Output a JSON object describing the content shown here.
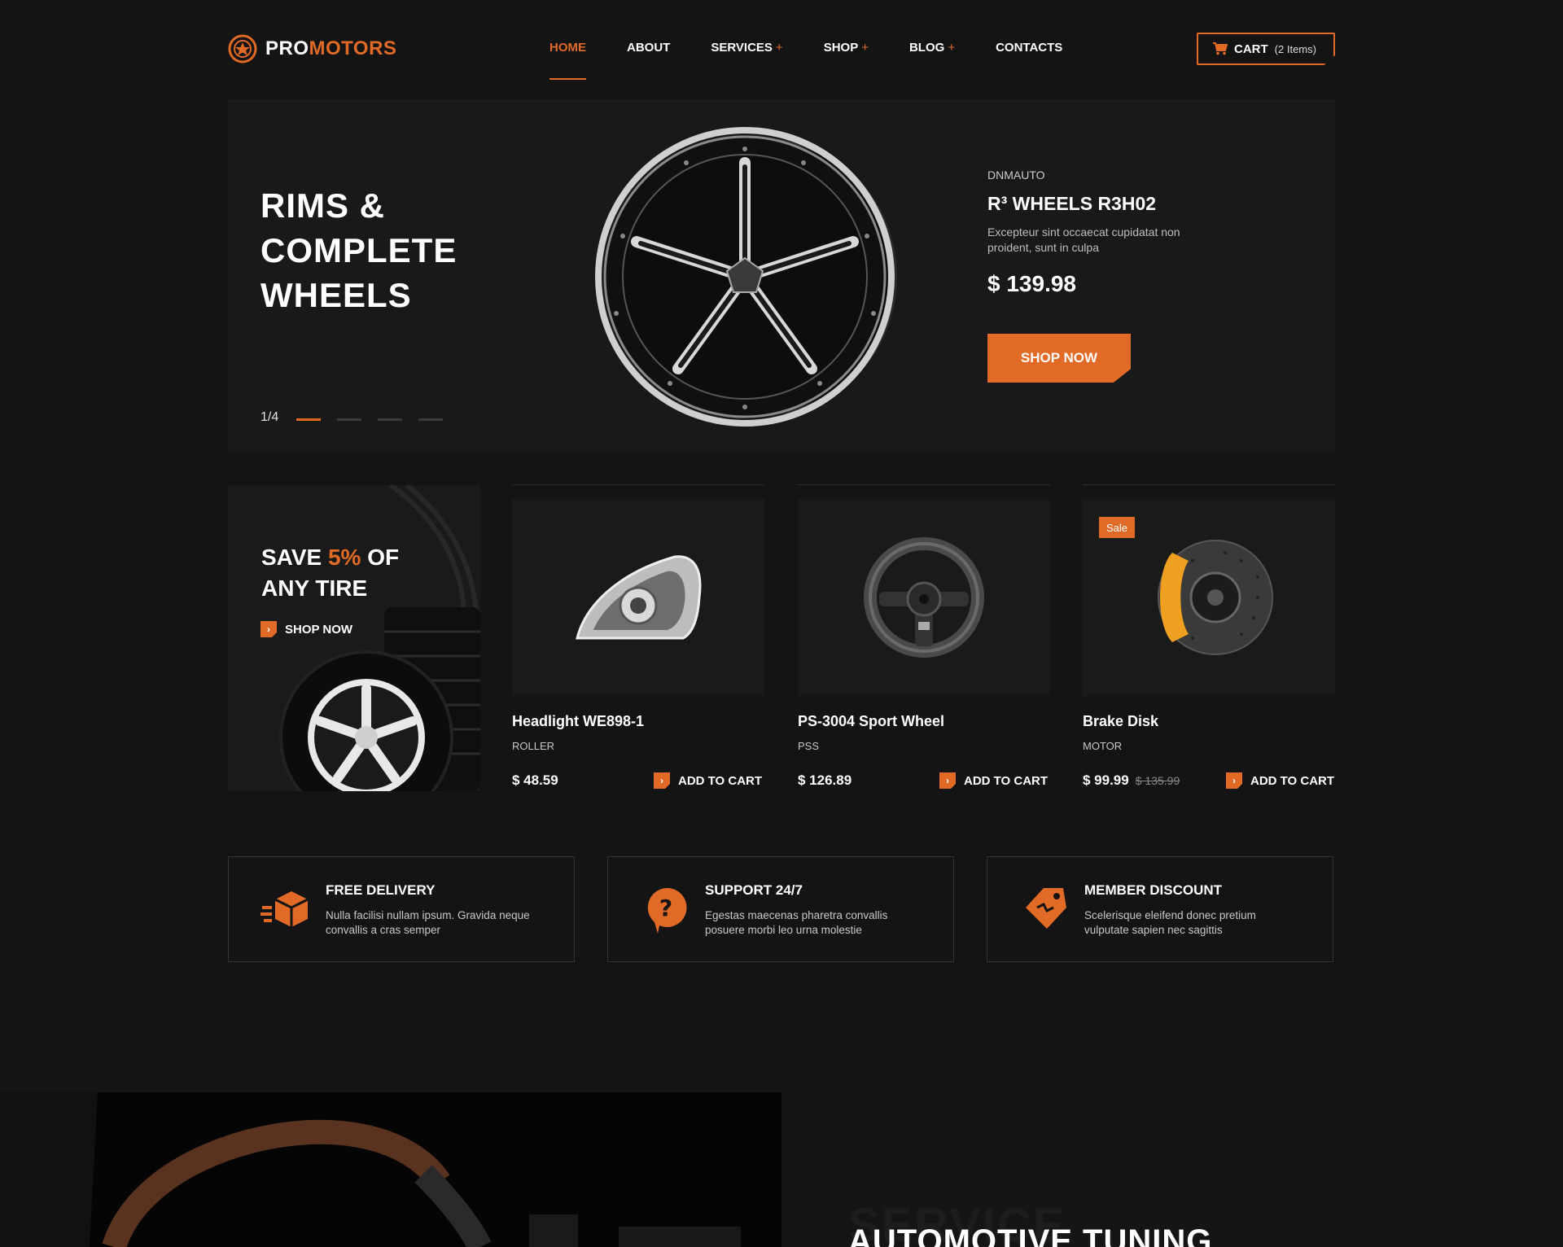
{
  "header": {
    "logo_pro": "PRO",
    "logo_motors": "MOTORS",
    "nav": [
      {
        "label": "HOME",
        "has_plus": false,
        "active": true
      },
      {
        "label": "ABOUT",
        "has_plus": false,
        "active": false
      },
      {
        "label": "SERVICES",
        "has_plus": true,
        "active": false
      },
      {
        "label": "SHOP",
        "has_plus": true,
        "active": false
      },
      {
        "label": "BLOG",
        "has_plus": true,
        "active": false
      },
      {
        "label": "CONTACTS",
        "has_plus": false,
        "active": false
      }
    ],
    "plus": "+",
    "cart_label": "CART",
    "cart_count": "(2 Items)"
  },
  "hero": {
    "title_lines": [
      "RIMS &",
      "COMPLETE",
      "WHEELS"
    ],
    "counter": "1/4",
    "slides_total": 4,
    "active_slide": 1,
    "brand": "DNMAUTO",
    "product": "R³ WHEELS R3H02",
    "description": "Excepteur sint occaecat cupidatat non proident, sunt in culpa",
    "price": "$ 139.98",
    "button": "SHOP NOW"
  },
  "promo": {
    "title_pre": "SAVE ",
    "title_accent": "5%",
    "title_post": " OF ANY TIRE",
    "button": "SHOP NOW",
    "arrow": "›"
  },
  "products": [
    {
      "name": "Headlight WE898-1",
      "brand": "ROLLER",
      "price": "$ 48.59",
      "old_price": "",
      "add": "ADD TO CART",
      "sale": ""
    },
    {
      "name": "PS-3004 Sport Wheel",
      "brand": "PSS",
      "price": "$ 126.89",
      "old_price": "",
      "add": "ADD TO CART",
      "sale": ""
    },
    {
      "name": "Brake Disk",
      "brand": "MOTOR",
      "price": "$ 99.99",
      "old_price": "$ 135.99",
      "add": "ADD TO CART",
      "sale": "Sale"
    }
  ],
  "features": [
    {
      "title": "FREE DELIVERY",
      "desc": "Nulla facilisi nullam ipsum. Gravida neque convallis a cras semper",
      "icon": "delivery-box-icon"
    },
    {
      "title": "SUPPORT 24/7",
      "desc": "Egestas maecenas pharetra convallis posuere morbi leo urna molestie",
      "icon": "support-question-icon"
    },
    {
      "title": "MEMBER DISCOUNT",
      "desc": "Scelerisque eleifend donec pretium vulputate sapien nec sagittis",
      "icon": "discount-tag-icon"
    }
  ],
  "service": {
    "ghost": "SERVICE",
    "title": "AUTOMOTIVE TUNING"
  },
  "colors": {
    "accent": "#e06a26",
    "background": "#141414",
    "panel": "#191919"
  }
}
